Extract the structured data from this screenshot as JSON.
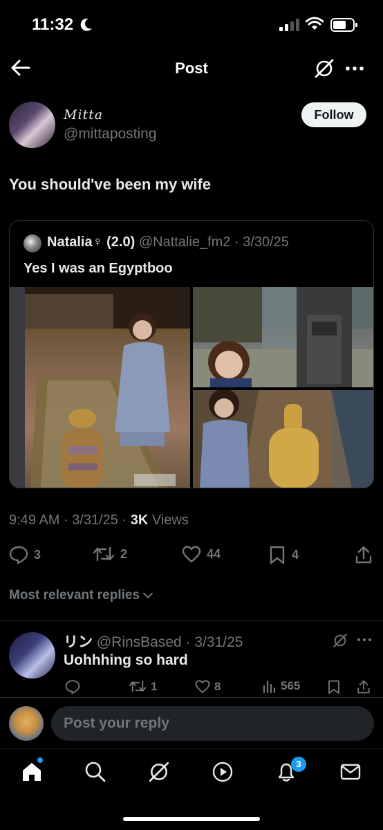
{
  "status_bar": {
    "time": "11:32"
  },
  "nav": {
    "title": "Post"
  },
  "post": {
    "author_name": "Mitta",
    "author_handle": "@mittaposting",
    "follow_label": "Follow",
    "text": "You should've been my wife",
    "quote": {
      "name": "Natalia♀ (2.0)",
      "handle": "@Nattalie_fm2",
      "date": "3/30/25",
      "text": "Yes I was an Egyptboo"
    },
    "time": "9:49 AM",
    "date": "3/31/25",
    "views_count": "3K",
    "views_label": "Views",
    "stats": {
      "replies": "3",
      "reposts": "2",
      "likes": "44",
      "bookmarks": "4"
    }
  },
  "replies_sort_label": "Most relevant replies",
  "reply": {
    "name": "リン",
    "handle": "@RinsBased",
    "date": "3/31/25",
    "text": "Uohhhing so hard",
    "stats": {
      "replies": "",
      "reposts": "1",
      "likes": "8",
      "views": "565"
    }
  },
  "composer": {
    "placeholder": "Post your reply"
  },
  "tabbar": {
    "notifications_badge": "3"
  },
  "colors": {
    "accent": "#1d9bf0",
    "background": "#000000",
    "muted": "#71767b"
  }
}
